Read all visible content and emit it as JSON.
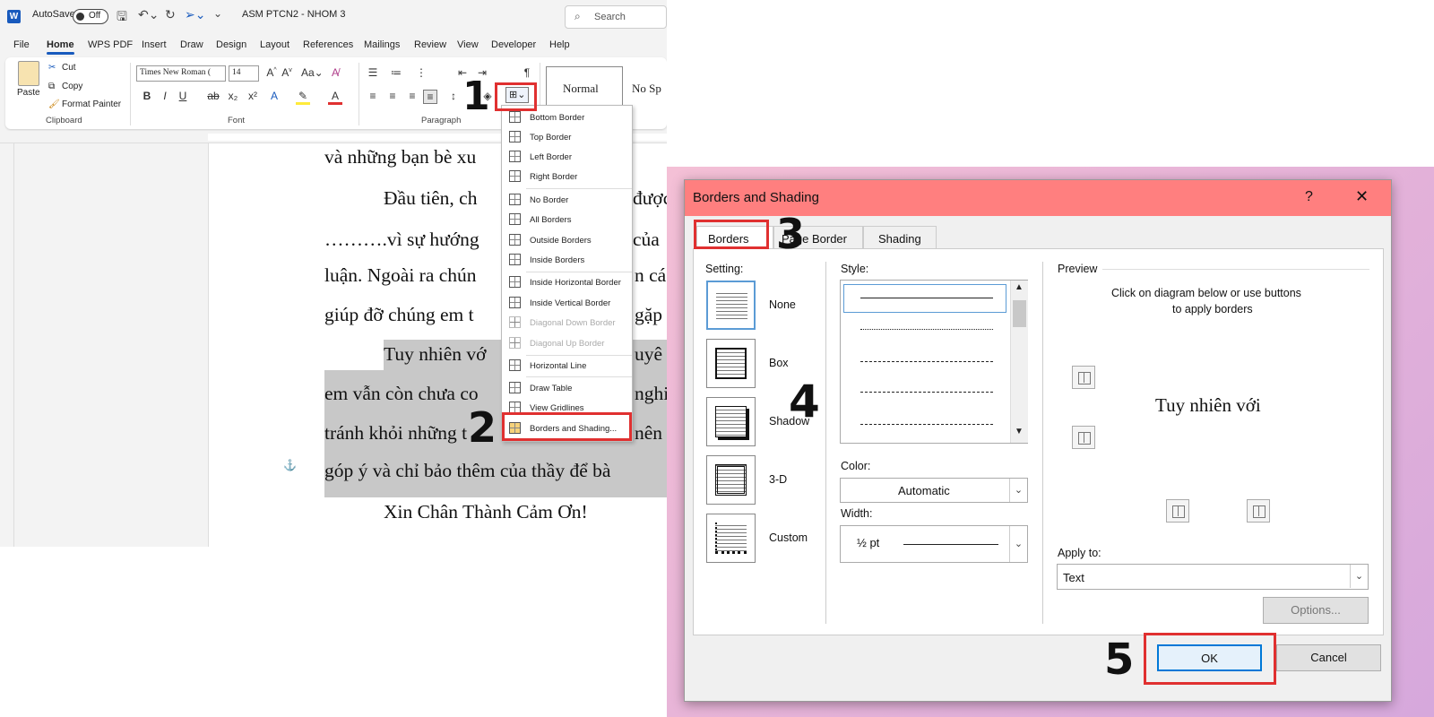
{
  "word": {
    "autosave_label": "AutoSave",
    "autosave_state": "Off",
    "doc_title": "ASM PTCN2 - NHOM 3",
    "search_placeholder": "Search",
    "menu": [
      "File",
      "Home",
      "WPS PDF",
      "Insert",
      "Draw",
      "Design",
      "Layout",
      "References",
      "Mailings",
      "Review",
      "View",
      "Developer",
      "Help"
    ],
    "ribbon": {
      "paste": "Paste",
      "cut": "Cut",
      "copy": "Copy",
      "format_painter": "Format Painter",
      "clipboard_group": "Clipboard",
      "font_name": "Times New Roman (",
      "font_size": "14",
      "font_group": "Font",
      "paragraph_group": "Paragraph",
      "style_normal": "Normal",
      "style_nospacing": "No Sp"
    },
    "document_lines": [
      "và những bạn bè xu",
      "Đầu tiên, ch",
      "được",
      "……….vì sự hướng",
      "của",
      "luận. Ngoài ra chún",
      "n cá",
      "giúp đỡ chúng em t",
      "gặp",
      "Tuy nhiên vớ",
      "uyê",
      "em vẫn còn chưa co",
      "nghiệ",
      "tránh khỏi những t",
      "nên",
      "góp ý và chỉ bảo thêm của thầy để bà",
      "Xin Chân Thành Cảm Ơn!"
    ],
    "border_menu": [
      {
        "label": "Bottom Border",
        "enabled": true
      },
      {
        "label": "Top Border",
        "enabled": true
      },
      {
        "label": "Left Border",
        "enabled": true
      },
      {
        "label": "Right Border",
        "enabled": true
      },
      {
        "label": "No Border",
        "enabled": true
      },
      {
        "label": "All Borders",
        "enabled": true
      },
      {
        "label": "Outside Borders",
        "enabled": true
      },
      {
        "label": "Inside Borders",
        "enabled": true
      },
      {
        "label": "Inside Horizontal Border",
        "enabled": true
      },
      {
        "label": "Inside Vertical Border",
        "enabled": true
      },
      {
        "label": "Diagonal Down Border",
        "enabled": false
      },
      {
        "label": "Diagonal Up Border",
        "enabled": false
      },
      {
        "label": "Horizontal Line",
        "enabled": true
      },
      {
        "label": "Draw Table",
        "enabled": true
      },
      {
        "label": "View Gridlines",
        "enabled": true
      },
      {
        "label": "Borders and Shading...",
        "enabled": true
      }
    ]
  },
  "steps": [
    "1",
    "2",
    "3",
    "4",
    "5"
  ],
  "dialog": {
    "title": "Borders and Shading",
    "help": "?",
    "close": "✕",
    "tabs": [
      "Borders",
      "Page Border",
      "Shading"
    ],
    "setting_label": "Setting:",
    "settings": [
      "None",
      "Box",
      "Shadow",
      "3-D",
      "Custom"
    ],
    "style_label": "Style:",
    "color_label": "Color:",
    "color_value": "Automatic",
    "width_label": "Width:",
    "width_value": "½ pt",
    "preview_label": "Preview",
    "preview_hint_1": "Click on diagram below or use buttons",
    "preview_hint_2": "to apply borders",
    "preview_text": "Tuy nhiên với",
    "apply_label": "Apply to:",
    "apply_value": "Text",
    "options_button": "Options...",
    "ok_button": "OK",
    "cancel_button": "Cancel"
  },
  "colors": {
    "highlight_red": "#e03030",
    "dialog_titlebar": "#ff7f7f",
    "word_blue": "#185abd"
  }
}
